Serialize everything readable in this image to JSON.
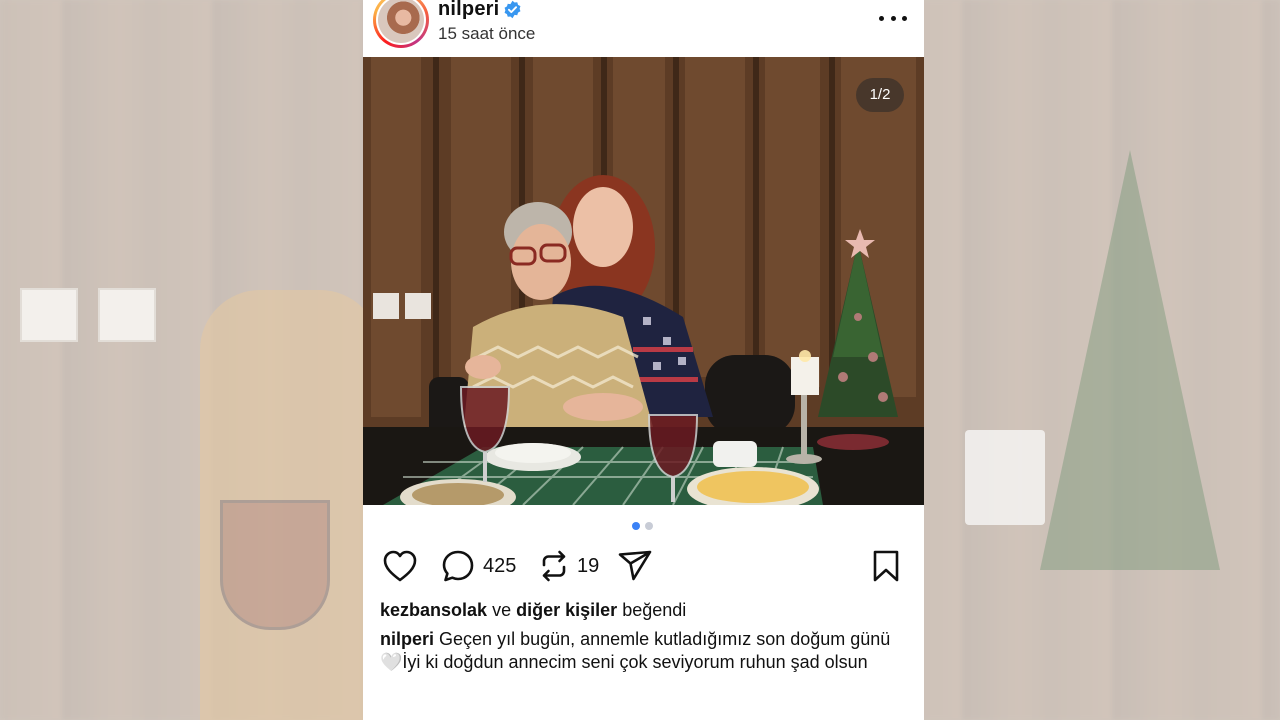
{
  "post": {
    "username": "nilperi",
    "timestamp": "15 saat önce",
    "image_counter": "1/2",
    "comments_count": "425",
    "reposts_count": "19",
    "likes": {
      "liker": "kezbansolak",
      "conjunction": "ve",
      "others": "diğer kişiler",
      "suffix": "beğendi"
    },
    "caption": {
      "username": "nilperi",
      "text": "Geçen yıl bugün, annemle kutladığımız son doğum günü🤍İyi ki doğdun annecim seni çok seviyorum ruhun şad olsun"
    }
  },
  "icons": {
    "verified": "verified-badge-icon",
    "more": "more-options-icon",
    "like": "heart-icon",
    "comment": "comment-bubble-icon",
    "repost": "repost-icon",
    "share": "send-icon",
    "save": "bookmark-icon"
  },
  "colors": {
    "verified_blue": "#3897f0",
    "dot_active": "#3b82f6"
  }
}
